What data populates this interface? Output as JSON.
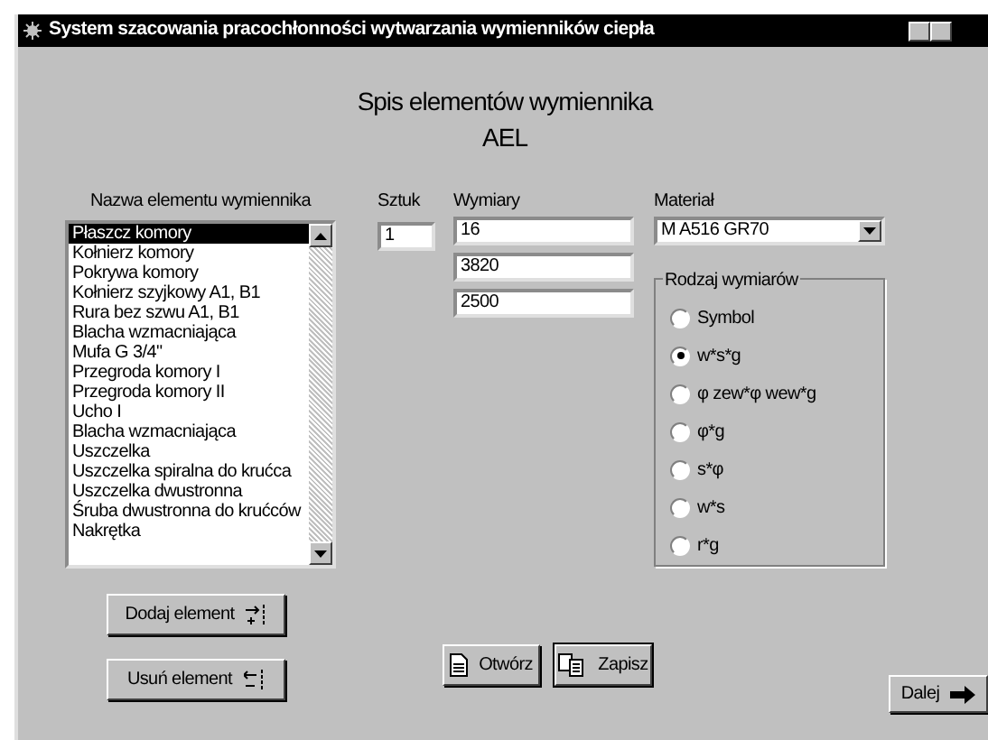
{
  "window": {
    "title": "System szacowania pracochłonności wytwarzania wymienników ciepła"
  },
  "heading": {
    "title": "Spis elementów wymiennika",
    "subtitle": "AEL"
  },
  "elements": {
    "label": "Nazwa elementu wymiennika",
    "items": [
      {
        "text": "Płaszcz komory",
        "selected": true
      },
      {
        "text": "Kołnierz komory",
        "selected": false
      },
      {
        "text": "Pokrywa komory",
        "selected": false
      },
      {
        "text": "Kołnierz szyjkowy A1, B1",
        "selected": false
      },
      {
        "text": "Rura bez szwu A1, B1",
        "selected": false
      },
      {
        "text": "Blacha wzmacniająca",
        "selected": false
      },
      {
        "text": "Mufa G 3/4\"",
        "selected": false
      },
      {
        "text": "Przegroda komory I",
        "selected": false
      },
      {
        "text": "Przegroda komory II",
        "selected": false
      },
      {
        "text": "Ucho I",
        "selected": false
      },
      {
        "text": "Blacha wzmacniająca",
        "selected": false
      },
      {
        "text": "Uszczelka",
        "selected": false
      },
      {
        "text": "Uszczelka spiralna do krućca",
        "selected": false
      },
      {
        "text": "Uszczelka dwustronna",
        "selected": false
      },
      {
        "text": "Śruba dwustronna do krućców",
        "selected": false
      },
      {
        "text": "Nakrętka",
        "selected": false
      }
    ]
  },
  "count": {
    "label": "Sztuk",
    "value": "1"
  },
  "dimensions": {
    "label": "Wymiary",
    "values": [
      "16",
      "3820",
      "2500"
    ]
  },
  "material": {
    "label": "Materiał",
    "value": "M A516 GR70"
  },
  "dimension_type": {
    "label": "Rodzaj wymiarów",
    "options": [
      {
        "text": "Symbol",
        "selected": false
      },
      {
        "text": "w*s*g",
        "selected": true
      },
      {
        "text": "φ zew*φ wew*g",
        "selected": false
      },
      {
        "text": "φ*g",
        "selected": false
      },
      {
        "text": "s*φ",
        "selected": false
      },
      {
        "text": "w*s",
        "selected": false
      },
      {
        "text": "r*g",
        "selected": false
      }
    ]
  },
  "buttons": [
    {
      "kind": "add",
      "label": "Dodaj element",
      "default": false
    },
    {
      "kind": "remove",
      "label": "Usuń element",
      "default": false
    },
    {
      "kind": "open",
      "label": "Otwórz",
      "default": false
    },
    {
      "kind": "save",
      "label": "Zapisz",
      "default": true
    },
    {
      "kind": "next",
      "label": "Dalej",
      "default": false
    }
  ]
}
